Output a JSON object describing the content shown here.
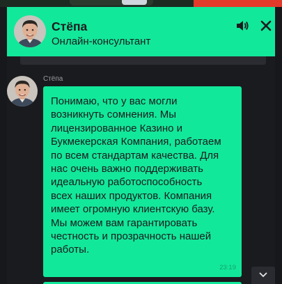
{
  "header": {
    "name": "Стёпа",
    "status": "Онлайн-консультант"
  },
  "icons": {
    "sound": "speaker-volume-icon",
    "close": "close-icon",
    "scroll_down": "chevron-down-icon"
  },
  "colors": {
    "accent": "#12e89a",
    "background": "#1a1b1f",
    "text_dark": "#1a1b1f",
    "timestamp": "#0ea56f",
    "sender_label": "#9a9ba0"
  },
  "messages": [
    {
      "sender": "Стёпа",
      "lines": [
        "Понимаю, что у вас могли",
        "возникнуть сомнения. Мы",
        "лицензированное Казино и",
        "Букмекерская Компания, работаем",
        "по всем стандартам качества. Для",
        "нас очень важно поддерживать",
        "идеальную работоспособность",
        "всех наших продуктов. Компания",
        "имеет огромную клиентскую базу.",
        "Мы можем вам гарантировать",
        "честность и прозрачность нашей",
        "работы."
      ],
      "time": "23:19"
    }
  ]
}
